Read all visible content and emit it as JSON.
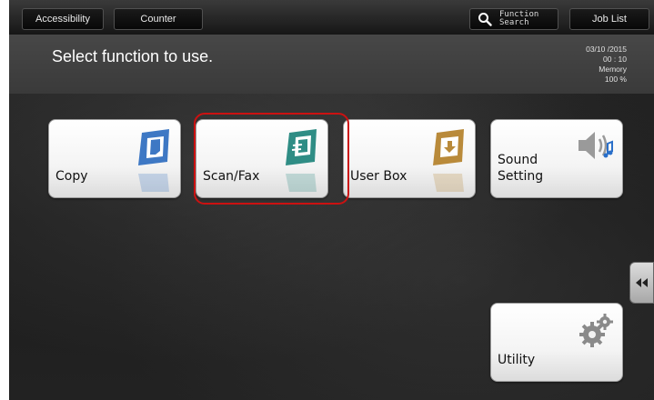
{
  "topbar": {
    "accessibility_label": "Accessibility",
    "counter_label": "Counter",
    "function_search_label_line1": "Function",
    "function_search_label_line2": "Search",
    "job_list_label": "Job List"
  },
  "message": "Select function to use.",
  "status": {
    "date": "03/10 /2015",
    "time": "00 : 10",
    "memory_label": "Memory",
    "memory_value": "100 %"
  },
  "tiles": {
    "copy": "Copy",
    "scan_fax": "Scan/Fax",
    "user_box": "User Box",
    "sound_setting_line1": "Sound",
    "sound_setting_line2": "Setting",
    "utility": "Utility"
  },
  "icons": {
    "copy": "copy-icon",
    "scan_fax": "scan-fax-icon",
    "user_box": "user-box-icon",
    "sound_setting": "speaker-icon",
    "utility": "gear-icon",
    "function_search": "search-icon",
    "side_tab": "double-chevron-left-icon"
  },
  "colors": {
    "copy_icon": "#3e78c4",
    "scan_fax_icon": "#2f8d85",
    "user_box_icon": "#b98a3a",
    "utility_icon": "#8a8a8a",
    "highlight": "#cc1111"
  }
}
